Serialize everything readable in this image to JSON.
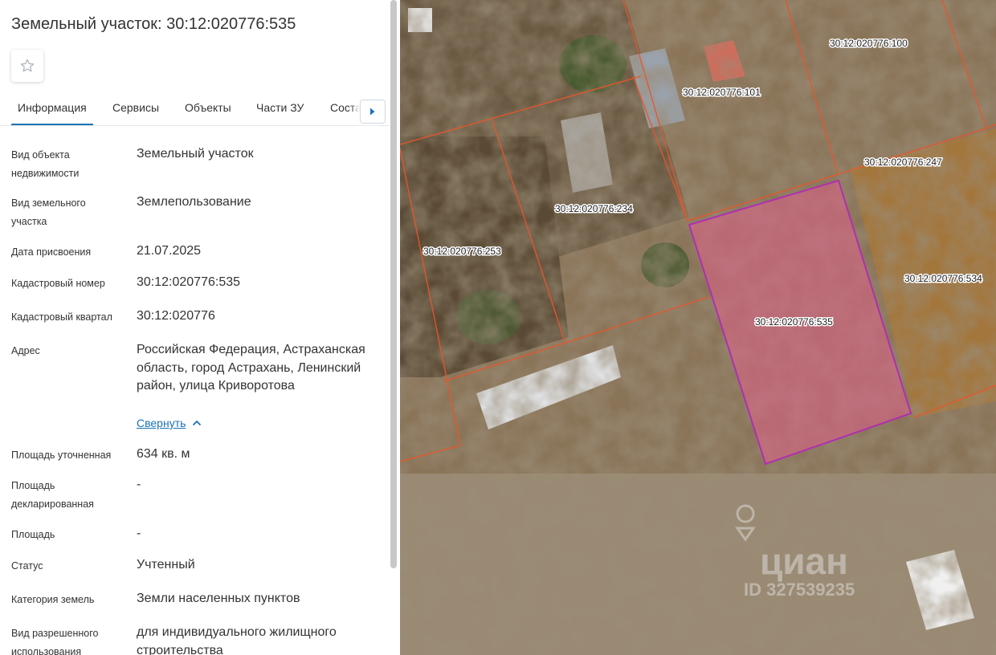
{
  "header": {
    "title": "Земельный участок: 30:12:020776:535"
  },
  "tabs": [
    {
      "label": "Информация"
    },
    {
      "label": "Сервисы"
    },
    {
      "label": "Объекты"
    },
    {
      "label": "Части ЗУ"
    },
    {
      "label": "Состав ЗУ"
    }
  ],
  "fields": [
    {
      "label": "Вид объекта недвижимости",
      "value": "Земельный участок"
    },
    {
      "label": "Вид земельного участка",
      "value": "Землепользование"
    },
    {
      "label": "Дата присвоения",
      "value": "21.07.2025"
    },
    {
      "label": "Кадастровый номер",
      "value": "30:12:020776:535"
    },
    {
      "label": "Кадастровый квартал",
      "value": "30:12:020776"
    },
    {
      "label": "Адрес",
      "value": "Российская Федерация, Астраханская область, город Астрахань, Ленинский район, улица Криворотова"
    },
    {
      "label": "Площадь уточненная",
      "value": "634 кв. м"
    },
    {
      "label": "Площадь декларированная",
      "value": "-"
    },
    {
      "label": "Площадь",
      "value": "-"
    },
    {
      "label": "Статус",
      "value": "Учтенный"
    },
    {
      "label": "Категория земель",
      "value": "Земли населенных пунктов"
    },
    {
      "label": "Вид разрешенного использования",
      "value": "для индивидуального жилищного строительства"
    }
  ],
  "collapse_link": "Свернуть",
  "map": {
    "parcels": [
      "30:12:020776:100",
      "30:12:020776:101",
      "30:12:020776:247",
      "30:12:020776:234",
      "30:12:020776:253",
      "30:12:020776:534",
      "30:12:020776:535"
    ],
    "watermark": {
      "brand": "циан",
      "id": "ID 327539235"
    },
    "colors": {
      "boundary": "#e8552a",
      "selected_stroke": "#b02fb0",
      "selected_fill": "#e0608a",
      "ground": "#8a7458"
    }
  }
}
